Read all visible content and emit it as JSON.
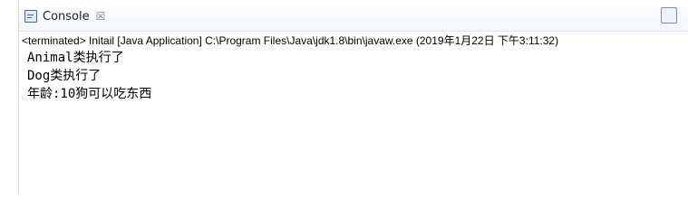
{
  "tab": {
    "title": "Console",
    "close_glyph": "☒"
  },
  "status": {
    "text": "<terminated> Initail [Java Application] C:\\Program Files\\Java\\jdk1.8\\bin\\javaw.exe (2019年1月22日 下午3:11:32)"
  },
  "output": {
    "lines": [
      "Animal类执行了",
      "Dog类执行了",
      "年龄:10狗可以吃东西"
    ]
  },
  "icons": {
    "console_tab_icon": "console-icon",
    "close_icon": "close-icon",
    "maximize_icon": "window-icon"
  }
}
